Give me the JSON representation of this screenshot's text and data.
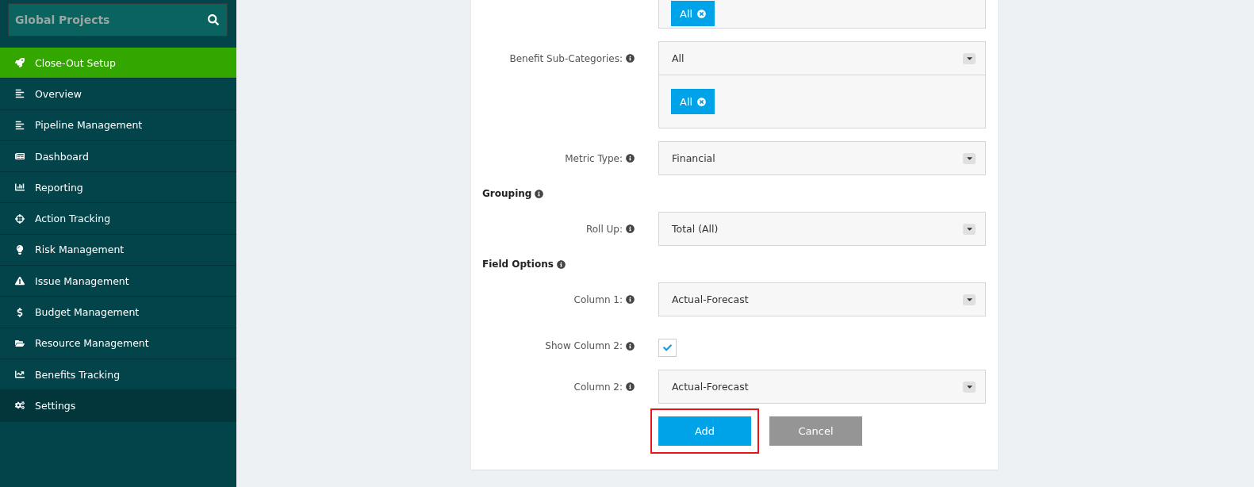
{
  "sidebar": {
    "search": {
      "placeholder": "Global Projects"
    },
    "items": [
      {
        "label": "Close-Out Setup",
        "selected": true,
        "hovered": false
      },
      {
        "label": "Overview",
        "selected": false,
        "hovered": false
      },
      {
        "label": "Pipeline Management",
        "selected": false,
        "hovered": false
      },
      {
        "label": "Dashboard",
        "selected": false,
        "hovered": false
      },
      {
        "label": "Reporting",
        "selected": false,
        "hovered": false
      },
      {
        "label": "Action Tracking",
        "selected": false,
        "hovered": false
      },
      {
        "label": "Risk Management",
        "selected": false,
        "hovered": false
      },
      {
        "label": "Issue Management",
        "selected": false,
        "hovered": false
      },
      {
        "label": "Budget Management",
        "selected": false,
        "hovered": false
      },
      {
        "label": "Resource Management",
        "selected": false,
        "hovered": false
      },
      {
        "label": "Benefits Tracking",
        "selected": false,
        "hovered": false
      },
      {
        "label": "Settings",
        "selected": false,
        "hovered": true
      }
    ]
  },
  "form": {
    "rows": [
      {
        "kind": "tags",
        "tags": [
          "All"
        ]
      },
      {
        "kind": "select",
        "label": "Benefit Sub-Categories:",
        "value": "All",
        "tags": [
          "All"
        ]
      },
      {
        "kind": "select",
        "label": "Metric Type:",
        "value": "Financial"
      },
      {
        "kind": "heading",
        "label": "Grouping"
      },
      {
        "kind": "select",
        "label": "Roll Up:",
        "value": "Total (All)"
      },
      {
        "kind": "heading",
        "label": "Field Options"
      },
      {
        "kind": "select",
        "label": "Column 1:",
        "value": "Actual-Forecast"
      },
      {
        "kind": "checkbox",
        "label": "Show Column 2:",
        "checked": true
      },
      {
        "kind": "select",
        "label": "Column 2:",
        "value": "Actual-Forecast"
      }
    ],
    "buttons": [
      {
        "label": "Add",
        "kind": "primary",
        "highlighted": true
      },
      {
        "label": "Cancel",
        "kind": "secondary",
        "highlighted": false
      }
    ]
  }
}
